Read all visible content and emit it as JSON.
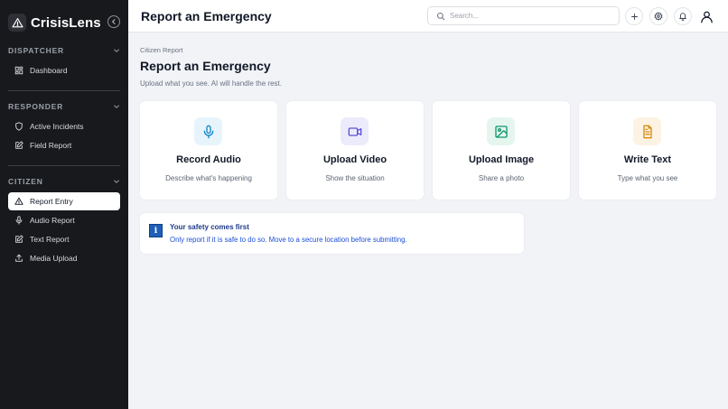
{
  "app": {
    "name": "CrisisLens"
  },
  "sidebar": {
    "sections": [
      {
        "title": "DISPATCHER",
        "items": [
          {
            "label": "Dashboard",
            "icon": "grid-icon"
          }
        ]
      },
      {
        "title": "RESPONDER",
        "items": [
          {
            "label": "Active Incidents",
            "icon": "shield-icon"
          },
          {
            "label": "Field Report",
            "icon": "edit-icon"
          }
        ]
      },
      {
        "title": "CITIZEN",
        "items": [
          {
            "label": "Report Entry",
            "icon": "alert-triangle-icon",
            "active": true
          },
          {
            "label": "Audio Report",
            "icon": "mic-icon"
          },
          {
            "label": "Text Report",
            "icon": "edit-icon"
          },
          {
            "label": "Media Upload",
            "icon": "upload-icon"
          }
        ]
      }
    ]
  },
  "header": {
    "title": "Report an Emergency",
    "search_placeholder": "Search..."
  },
  "main": {
    "breadcrumb": "Citizen Report",
    "title": "Report an Emergency",
    "subtitle": "Upload what you see. AI will handle the rest.",
    "cards": [
      {
        "title": "Record Audio",
        "desc": "Describe what's happening",
        "icon": "mic-icon",
        "color": "#0e86c7",
        "bg": "#e7f4fb"
      },
      {
        "title": "Upload Video",
        "desc": "Show the situation",
        "icon": "video-icon",
        "color": "#5b4fd6",
        "bg": "#ecebfb"
      },
      {
        "title": "Upload Image",
        "desc": "Share a photo",
        "icon": "image-icon",
        "color": "#11956c",
        "bg": "#e5f6ef"
      },
      {
        "title": "Write Text",
        "desc": "Type what you see",
        "icon": "file-text-icon",
        "color": "#d98a12",
        "bg": "#fdf3e3"
      }
    ],
    "notice": {
      "icon_glyph": "i",
      "title": "Your safety comes first",
      "text": "Only report if it is safe to do so. Move to a secure location before submitting."
    }
  },
  "colors": {
    "sidebar_bg": "#17191d",
    "page_bg": "#f1f3f7",
    "notice_text": "#1d4ed8"
  }
}
